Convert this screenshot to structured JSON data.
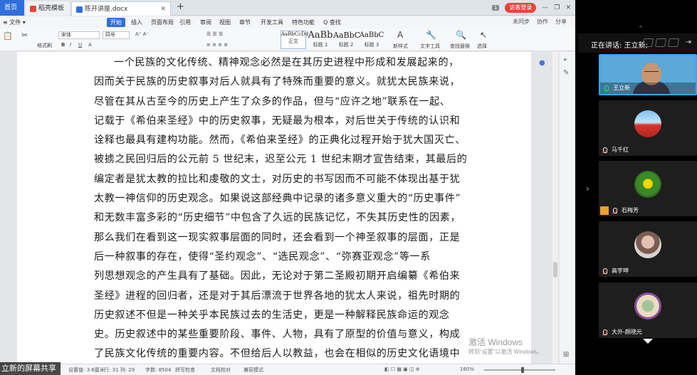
{
  "tabs": {
    "home": "首页",
    "template": "稻壳模板",
    "doc": "陈开讲座.docx",
    "add": "+"
  },
  "window_right": {
    "badge": "1",
    "visitor": "访客登录"
  },
  "menu": {
    "file": "文件",
    "items": [
      "开始",
      "插入",
      "页面布局",
      "引用",
      "审阅",
      "视图",
      "章节",
      "开发工具",
      "特色功能",
      "Q 查找"
    ],
    "right": [
      "未同步",
      "协作",
      "分享"
    ]
  },
  "ribbon": {
    "paste": "格式刷",
    "font": "宋体",
    "size": "四号",
    "styles": [
      {
        "sample": "AaBbCcDd",
        "name": "正文"
      },
      {
        "sample": "AaBb",
        "name": "标题 1"
      },
      {
        "sample": "AaBbC",
        "name": "标题 2"
      },
      {
        "sample": "AaBbC",
        "name": "标题 3"
      }
    ],
    "new_style": "新样式",
    "text_tools": "文字工具",
    "find_replace": "查找替换",
    "select": "选择"
  },
  "document": {
    "lines": [
      "一个民族的文化传统、精神观念必然是在其历史进程中形成和发展起来的，",
      "因而关于民族的历史叙事对后人就具有了特殊而重要的意义。就犹太民族来说，",
      "尽管在其从古至今的历史上产生了众多的作品，但与“应许之地”联系在一起、",
      "记载于《希伯来圣经》中的历史叙事，无疑最为根本，对后世关于传统的认识和",
      "诠释也最具有建构功能。然而，《希伯来圣经》的正典化过程开始于犹大国灭亡、",
      "被掳之民回归后的公元前 5 世纪末，迟至公元 1 世纪末期才宣告结束，其最后的",
      "编定者是犹太教的拉比和虔敬的文士，对历史的书写因而不可能不体现出基于犹",
      "太教一神信仰的历史观念。如果说这部经典中记录的诸多意义重大的“历史事件”",
      "和无数丰富多彩的“历史细节”中包含了久远的民族记忆，不失其历史性的因素，",
      "那么我们在看到这一现实叙事层面的同时，还会看到一个神圣叙事的层面，正是",
      "后一种叙事的存在，使得“圣约观念”、“选民观念”、“弥赛亚观念”等一系",
      "列思想观念的产生具有了基础。因此，无论对于第二圣殿初期开启编纂《希伯来",
      "圣经》进程的回归者，还是对于其后漂流于世界各地的犹太人来说，祖先时期的",
      "历史叙述不但是一种关乎本民族过去的生活史，更是一种解释民族命运的观念",
      "史。历史叙述中的某些重要阶段、事件、人物，具有了原型的价值与意义，构成",
      "了民族文化传统的重要内容。不但给后人以教益，也会在相似的历史文化语境中"
    ]
  },
  "watermark": {
    "line1": "激活 Windows",
    "line2": "转到“设置”以激活 Windows。"
  },
  "statusbar": {
    "page": "设置值: 3.6厘米",
    "row": "行: 31 列: 29",
    "words": "字数: 8504",
    "spell": "拼写检查",
    "proof": "文档校对",
    "revise": "兼容模式",
    "zoom": "160%"
  },
  "share_label": "立新的屏幕共享",
  "meeting": {
    "speaking": "正在讲话: 王立新;",
    "participants": [
      {
        "name": "王立新",
        "muted": false
      },
      {
        "name": "马千红",
        "muted": true
      },
      {
        "name": "石梅芳",
        "muted": true
      },
      {
        "name": "高宇坤",
        "muted": true
      },
      {
        "name": "大外-颜晓元",
        "muted": true
      }
    ]
  }
}
